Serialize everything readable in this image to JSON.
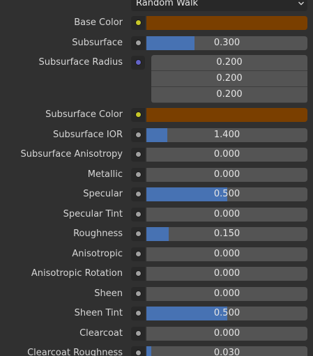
{
  "dropdown": {
    "value": "Random Walk",
    "icon": "chevron-down-icon"
  },
  "colors": {
    "accent": "#4772b3",
    "base_color": "#7a3f00",
    "subsurface_color": "#7a3f00"
  },
  "properties": [
    {
      "id": "base-color",
      "label": "Base Color",
      "kind": "color",
      "socket": "yellow"
    },
    {
      "id": "subsurface",
      "label": "Subsurface",
      "kind": "slider",
      "value": "0.300",
      "fill": 0.3,
      "socket": "grey"
    },
    {
      "id": "subsurface-radius",
      "label": "Subsurface Radius",
      "kind": "vector",
      "socket": "blue",
      "values": [
        "0.200",
        "0.200",
        "0.200"
      ]
    },
    {
      "id": "subsurface-color",
      "label": "Subsurface Color",
      "kind": "color",
      "socket": "yellow"
    },
    {
      "id": "subsurface-ior",
      "label": "Subsurface IOR",
      "kind": "slider",
      "value": "1.400",
      "fill": 0.13,
      "socket": "grey"
    },
    {
      "id": "subsurface-anisotropy",
      "label": "Subsurface Anisotropy",
      "kind": "slider",
      "value": "0.000",
      "fill": 0,
      "socket": "grey"
    },
    {
      "id": "metallic",
      "label": "Metallic",
      "kind": "slider",
      "value": "0.000",
      "fill": 0,
      "socket": "grey"
    },
    {
      "id": "specular",
      "label": "Specular",
      "kind": "slider",
      "value": "0.500",
      "fill": 0.5,
      "socket": "grey"
    },
    {
      "id": "specular-tint",
      "label": "Specular Tint",
      "kind": "slider",
      "value": "0.000",
      "fill": 0,
      "socket": "grey"
    },
    {
      "id": "roughness",
      "label": "Roughness",
      "kind": "slider",
      "value": "0.150",
      "fill": 0.14,
      "socket": "grey"
    },
    {
      "id": "anisotropic",
      "label": "Anisotropic",
      "kind": "slider",
      "value": "0.000",
      "fill": 0,
      "socket": "grey"
    },
    {
      "id": "anisotropic-rotation",
      "label": "Anisotropic Rotation",
      "kind": "slider",
      "value": "0.000",
      "fill": 0,
      "socket": "grey"
    },
    {
      "id": "sheen",
      "label": "Sheen",
      "kind": "slider",
      "value": "0.000",
      "fill": 0,
      "socket": "grey"
    },
    {
      "id": "sheen-tint",
      "label": "Sheen Tint",
      "kind": "slider",
      "value": "0.500",
      "fill": 0.5,
      "socket": "grey"
    },
    {
      "id": "clearcoat",
      "label": "Clearcoat",
      "kind": "slider",
      "value": "0.000",
      "fill": 0,
      "socket": "grey"
    },
    {
      "id": "clearcoat-roughness",
      "label": "Clearcoat Roughness",
      "kind": "slider",
      "value": "0.030",
      "fill": 0.03,
      "socket": "grey"
    }
  ]
}
